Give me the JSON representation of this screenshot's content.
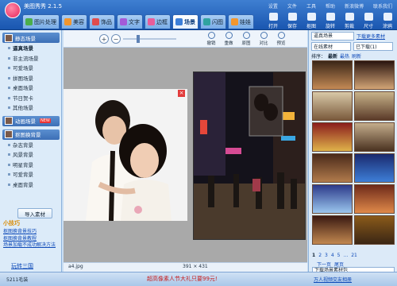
{
  "app": {
    "title": "美图秀秀 2.1.5"
  },
  "tabs": [
    {
      "label": "图片处理",
      "icon": "photo-icon"
    },
    {
      "label": "美容",
      "icon": "face-icon"
    },
    {
      "label": "饰品",
      "icon": "heart-icon"
    },
    {
      "label": "文字",
      "icon": "text-icon"
    },
    {
      "label": "边框",
      "icon": "frame-icon"
    },
    {
      "label": "场景",
      "icon": "scene-icon",
      "active": true
    },
    {
      "label": "闪图",
      "icon": "flash-icon"
    },
    {
      "label": "娃娃",
      "icon": "doll-icon"
    }
  ],
  "top_menu": [
    "设置",
    "文件",
    "工具",
    "帮助",
    "新浪微博",
    "联系我们"
  ],
  "right_tools": [
    "打开",
    "保存",
    "抠图",
    "旋转",
    "剪裁",
    "尺寸",
    "涂鸦",
    "撤销",
    "重做"
  ],
  "left_panel": {
    "header1": "静态场景",
    "static_items": [
      "逼真场景",
      "非主流场景",
      "可爱场景",
      "拼图场景",
      "桌面场景",
      "节日贺卡",
      "其他场景"
    ],
    "header2": "动画场景",
    "new_badge": "NEW",
    "header3": "抠图换背景",
    "bg_items": [
      "杂志背景",
      "风景背景",
      "明星背景",
      "可爱背景",
      "桌面背景"
    ],
    "import_label": "导入素材",
    "tips_title": "小技巧",
    "tip_links": [
      "抠图换背景技巧",
      "抠图换背景教程",
      "场景加载不成功解决方法"
    ],
    "bottom_link": "玩转三国"
  },
  "canvas_toolbar": {
    "buttons": [
      "撤销",
      "重做",
      "原图",
      "对比",
      "预览"
    ]
  },
  "status": {
    "filename": "a4.jpg",
    "dimensions": "391 × 431"
  },
  "right_panel": {
    "select_value": "逼真场景",
    "download_link": "下载更多素材",
    "online_tab": "在线素材",
    "downloaded_tab": "已下载(1)",
    "sort_label": "排序：",
    "sort_newest": "最新",
    "sort_hot": "最热",
    "refresh_label": "刷新",
    "pager": [
      "1",
      "2",
      "3",
      "4",
      "5",
      "...",
      "21"
    ],
    "pager_prev": "下一页",
    "pager_last": "尾页",
    "dl_select": "下载场景素材包"
  },
  "footer": {
    "left": "5211毛装",
    "middle": "超高像素人节大礼只要99元!",
    "right": "万人视频交友相册"
  }
}
